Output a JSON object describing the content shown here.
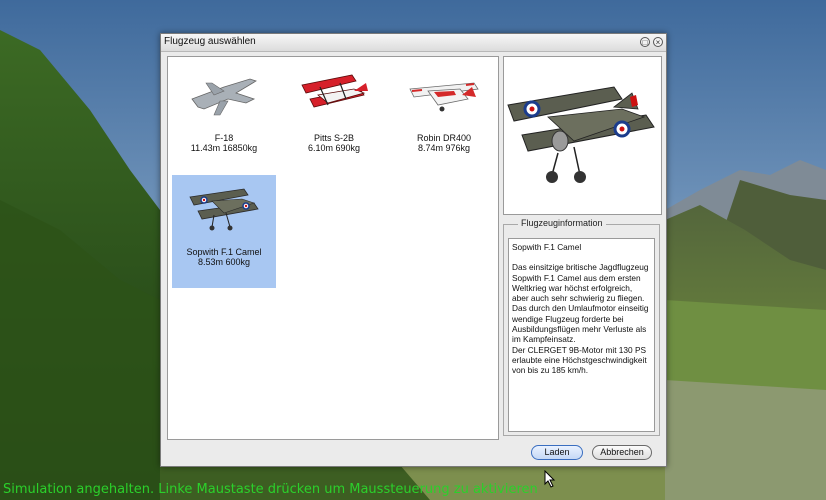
{
  "status_text": "Simulation angehalten. Linke Maustaste drücken um Maussteuerung zu aktivieren",
  "dialog": {
    "title": "Flugzeug auswählen",
    "aircraft": [
      {
        "name": "F-18",
        "spec": "11.43m 16850kg",
        "icon": "jet-icon",
        "selected": false
      },
      {
        "name": "Pitts S-2B",
        "spec": "6.10m 690kg",
        "icon": "biplane-icon",
        "selected": false
      },
      {
        "name": "Robin DR400",
        "spec": "8.74m 976kg",
        "icon": "light-aircraft-icon",
        "selected": false
      },
      {
        "name": "Sopwith F.1 Camel",
        "spec": "8.53m 600kg",
        "icon": "biplane-icon",
        "selected": true
      }
    ],
    "info": {
      "legend": "Flugzeuginformation",
      "title": "Sopwith F.1 Camel",
      "text": "Das einsitzige britische Jagdflugzeug Sopwith F.1 Camel aus dem ersten Weltkrieg war höchst erfolgreich, aber auch sehr schwierig zu fliegen. Das durch den Umlaufmotor einseitig wendige Flugzeug forderte bei Ausbildungsflügen mehr Verluste als im Kampfeinsatz.\nDer CLERGET 9B-Motor mit 130 PS erlaubte eine Höchstgeschwindigkeit von bis zu 185 km/h."
    },
    "buttons": {
      "load": "Laden",
      "cancel": "Abbrechen"
    }
  },
  "colors": {
    "status": "#2bd02b",
    "selection": "#a8c7f2"
  }
}
